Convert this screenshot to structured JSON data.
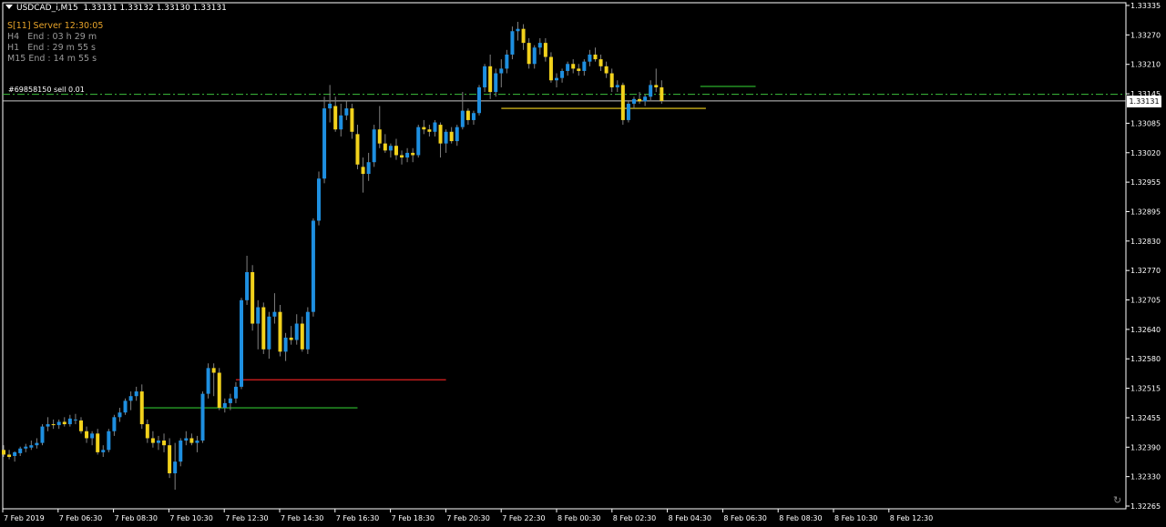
{
  "header": {
    "symbol": "USDCAD_i,M15",
    "quotes": "1.33131 1.33132 1.33130 1.33131"
  },
  "info_panel": {
    "server": "S[11] Server 12:30:05",
    "timeframes": [
      {
        "tf": "H4",
        "text": "End : 03 h 29 m"
      },
      {
        "tf": "H1",
        "text": "End : 29 m 55 s"
      },
      {
        "tf": "M15",
        "text": "End : 14 m 55 s"
      }
    ]
  },
  "trade": {
    "label": "#69858150 sell 0.01",
    "price": 1.33145
  },
  "current_price": "1.33131",
  "colors": {
    "background": "#000000",
    "bull": "#1e8fe0",
    "bear": "#f2d21c",
    "wick": "#808080",
    "axis": "#ffffff",
    "trade_line": "#3cc03c",
    "support": "#2fc22f",
    "resistance": "#e02020",
    "level_yellow": "#f2d21c"
  },
  "chart_data": {
    "type": "candlestick",
    "y_ticks": [
      "1.33335",
      "1.33270",
      "1.33210",
      "1.33145",
      "1.33085",
      "1.33020",
      "1.32955",
      "1.32895",
      "1.32830",
      "1.32770",
      "1.32705",
      "1.32640",
      "1.32580",
      "1.32515",
      "1.32455",
      "1.32390",
      "1.32330",
      "1.32265"
    ],
    "ylim": [
      1.32265,
      1.33335
    ],
    "x_ticks": [
      "7 Feb 2019",
      "7 Feb 06:30",
      "7 Feb 08:30",
      "7 Feb 10:30",
      "7 Feb 12:30",
      "7 Feb 14:30",
      "7 Feb 16:30",
      "7 Feb 18:30",
      "7 Feb 20:30",
      "7 Feb 22:30",
      "8 Feb 00:30",
      "8 Feb 02:30",
      "8 Feb 04:30",
      "8 Feb 06:30",
      "8 Feb 08:30",
      "8 Feb 10:30",
      "8 Feb 12:30"
    ],
    "candles": [
      [
        1.32385,
        1.32395,
        1.3237,
        1.32375
      ],
      [
        1.32375,
        1.32385,
        1.32365,
        1.3237
      ],
      [
        1.32372,
        1.32382,
        1.3236,
        1.3238
      ],
      [
        1.32378,
        1.32392,
        1.32372,
        1.32388
      ],
      [
        1.32388,
        1.32398,
        1.3238,
        1.32392
      ],
      [
        1.3239,
        1.32405,
        1.32385,
        1.32395
      ],
      [
        1.32395,
        1.3241,
        1.32388,
        1.324
      ],
      [
        1.324,
        1.3244,
        1.32395,
        1.32435
      ],
      [
        1.32435,
        1.32455,
        1.32425,
        1.3244
      ],
      [
        1.3244,
        1.3245,
        1.3243,
        1.32438
      ],
      [
        1.32438,
        1.3245,
        1.3243,
        1.32445
      ],
      [
        1.32445,
        1.32455,
        1.32435,
        1.3244
      ],
      [
        1.3244,
        1.3246,
        1.32435,
        1.32452
      ],
      [
        1.3245,
        1.32462,
        1.3244,
        1.3245
      ],
      [
        1.32448,
        1.32455,
        1.3242,
        1.32425
      ],
      [
        1.32425,
        1.32435,
        1.324,
        1.3241
      ],
      [
        1.3241,
        1.32425,
        1.32395,
        1.3242
      ],
      [
        1.3242,
        1.3243,
        1.32375,
        1.3238
      ],
      [
        1.3238,
        1.32395,
        1.3237,
        1.32385
      ],
      [
        1.32385,
        1.3243,
        1.3238,
        1.32425
      ],
      [
        1.32425,
        1.3246,
        1.32415,
        1.32455
      ],
      [
        1.32455,
        1.32475,
        1.32445,
        1.32465
      ],
      [
        1.32465,
        1.32495,
        1.3246,
        1.3249
      ],
      [
        1.3249,
        1.3251,
        1.3247,
        1.325
      ],
      [
        1.325,
        1.3252,
        1.3249,
        1.3251
      ],
      [
        1.3251,
        1.32525,
        1.3243,
        1.3244
      ],
      [
        1.3244,
        1.3245,
        1.324,
        1.3241
      ],
      [
        1.3241,
        1.32425,
        1.3239,
        1.324
      ],
      [
        1.324,
        1.32415,
        1.32385,
        1.32405
      ],
      [
        1.32405,
        1.3242,
        1.3238,
        1.32395
      ],
      [
        1.32395,
        1.3241,
        1.32325,
        1.32335
      ],
      [
        1.32335,
        1.324,
        1.323,
        1.3236
      ],
      [
        1.3236,
        1.3241,
        1.3235,
        1.32405
      ],
      [
        1.32405,
        1.32425,
        1.32395,
        1.3241
      ],
      [
        1.3241,
        1.3242,
        1.32395,
        1.324
      ],
      [
        1.324,
        1.32415,
        1.3238,
        1.32405
      ],
      [
        1.32405,
        1.3251,
        1.324,
        1.32505
      ],
      [
        1.32505,
        1.3257,
        1.32495,
        1.3256
      ],
      [
        1.3256,
        1.3257,
        1.325,
        1.3255
      ],
      [
        1.3255,
        1.3256,
        1.3247,
        1.32475
      ],
      [
        1.32475,
        1.32495,
        1.32465,
        1.32485
      ],
      [
        1.32485,
        1.32505,
        1.3247,
        1.32495
      ],
      [
        1.32495,
        1.3253,
        1.32485,
        1.3252
      ],
      [
        1.3252,
        1.3271,
        1.32515,
        1.32705
      ],
      [
        1.32705,
        1.328,
        1.32695,
        1.32765
      ],
      [
        1.32765,
        1.3278,
        1.3264,
        1.32655
      ],
      [
        1.32655,
        1.32705,
        1.326,
        1.3269
      ],
      [
        1.3269,
        1.327,
        1.3259,
        1.326
      ],
      [
        1.326,
        1.3268,
        1.3258,
        1.3267
      ],
      [
        1.3267,
        1.3272,
        1.32655,
        1.3268
      ],
      [
        1.3268,
        1.32695,
        1.32585,
        1.32595
      ],
      [
        1.32595,
        1.32635,
        1.32575,
        1.32625
      ],
      [
        1.32625,
        1.3265,
        1.3261,
        1.3262
      ],
      [
        1.3262,
        1.32675,
        1.3261,
        1.32655
      ],
      [
        1.32655,
        1.3267,
        1.32595,
        1.326
      ],
      [
        1.326,
        1.3269,
        1.3259,
        1.3268
      ],
      [
        1.3268,
        1.3288,
        1.3267,
        1.32875
      ],
      [
        1.32875,
        1.3298,
        1.32865,
        1.32965
      ],
      [
        1.32965,
        1.3314,
        1.32955,
        1.33115
      ],
      [
        1.33115,
        1.33165,
        1.33085,
        1.33125
      ],
      [
        1.3312,
        1.3314,
        1.33065,
        1.3307
      ],
      [
        1.3307,
        1.33125,
        1.33055,
        1.331
      ],
      [
        1.331,
        1.3313,
        1.3309,
        1.33115
      ],
      [
        1.33115,
        1.33125,
        1.3305,
        1.33065
      ],
      [
        1.3306,
        1.3308,
        1.32985,
        1.32995
      ],
      [
        1.3299,
        1.3301,
        1.32935,
        1.32975
      ],
      [
        1.32975,
        1.3302,
        1.3296,
        1.33
      ],
      [
        1.33,
        1.3308,
        1.3299,
        1.3307
      ],
      [
        1.3307,
        1.3312,
        1.3303,
        1.3304
      ],
      [
        1.3304,
        1.3306,
        1.3302,
        1.33025
      ],
      [
        1.33025,
        1.3304,
        1.3301,
        1.33035
      ],
      [
        1.33035,
        1.3305,
        1.33005,
        1.33015
      ],
      [
        1.33015,
        1.33025,
        1.32995,
        1.3301
      ],
      [
        1.3301,
        1.3303,
        1.33,
        1.3302
      ],
      [
        1.3302,
        1.3303,
        1.33,
        1.33015
      ],
      [
        1.33015,
        1.3308,
        1.3301,
        1.33075
      ],
      [
        1.33075,
        1.3309,
        1.3306,
        1.3307
      ],
      [
        1.3307,
        1.3308,
        1.33055,
        1.33065
      ],
      [
        1.33065,
        1.3309,
        1.33055,
        1.33085
      ],
      [
        1.3308,
        1.33085,
        1.3301,
        1.3304
      ],
      [
        1.3304,
        1.3307,
        1.3302,
        1.33065
      ],
      [
        1.33065,
        1.33075,
        1.3304,
        1.33045
      ],
      [
        1.33045,
        1.3308,
        1.33035,
        1.33075
      ],
      [
        1.33075,
        1.3315,
        1.3307,
        1.3311
      ],
      [
        1.3311,
        1.33115,
        1.3308,
        1.3309
      ],
      [
        1.3309,
        1.3311,
        1.3308,
        1.33105
      ],
      [
        1.33105,
        1.33165,
        1.331,
        1.3316
      ],
      [
        1.3316,
        1.3321,
        1.3315,
        1.33205
      ],
      [
        1.33205,
        1.3323,
        1.33135,
        1.3315
      ],
      [
        1.3315,
        1.332,
        1.3314,
        1.3319
      ],
      [
        1.3319,
        1.3322,
        1.3316,
        1.332
      ],
      [
        1.332,
        1.3324,
        1.3319,
        1.3323
      ],
      [
        1.3323,
        1.3329,
        1.3322,
        1.3328
      ],
      [
        1.3328,
        1.333,
        1.3326,
        1.33285
      ],
      [
        1.33285,
        1.33295,
        1.3324,
        1.33255
      ],
      [
        1.33255,
        1.33265,
        1.332,
        1.3321
      ],
      [
        1.3321,
        1.3325,
        1.332,
        1.33245
      ],
      [
        1.33245,
        1.33265,
        1.3323,
        1.33255
      ],
      [
        1.33255,
        1.33265,
        1.33215,
        1.33225
      ],
      [
        1.33225,
        1.33235,
        1.3317,
        1.33175
      ],
      [
        1.33175,
        1.3319,
        1.3316,
        1.3318
      ],
      [
        1.3318,
        1.332,
        1.3317,
        1.33195
      ],
      [
        1.33195,
        1.33215,
        1.33185,
        1.3321
      ],
      [
        1.3321,
        1.3322,
        1.3319,
        1.332
      ],
      [
        1.332,
        1.3321,
        1.33185,
        1.33195
      ],
      [
        1.33195,
        1.3322,
        1.33185,
        1.33215
      ],
      [
        1.33215,
        1.3324,
        1.33205,
        1.3323
      ],
      [
        1.3323,
        1.33245,
        1.33215,
        1.3322
      ],
      [
        1.3322,
        1.3323,
        1.33195,
        1.33205
      ],
      [
        1.33205,
        1.33215,
        1.3318,
        1.3319
      ],
      [
        1.3319,
        1.332,
        1.3315,
        1.3316
      ],
      [
        1.3316,
        1.33175,
        1.3315,
        1.33165
      ],
      [
        1.33165,
        1.3317,
        1.3308,
        1.3309
      ],
      [
        1.3309,
        1.3313,
        1.33085,
        1.33125
      ],
      [
        1.33125,
        1.3314,
        1.33115,
        1.33135
      ],
      [
        1.33135,
        1.3315,
        1.33125,
        1.3313
      ],
      [
        1.3313,
        1.33145,
        1.3312,
        1.3314
      ],
      [
        1.3314,
        1.33175,
        1.3313,
        1.33165
      ],
      [
        1.33165,
        1.332,
        1.3315,
        1.3316
      ],
      [
        1.3316,
        1.33175,
        1.33125,
        1.33131
      ]
    ],
    "levels": [
      {
        "name": "trade-sell-line",
        "price": 1.33145,
        "style": "dashdot",
        "color": "#3cc03c"
      },
      {
        "name": "current-price-line",
        "price": 1.33131,
        "style": "solid",
        "color": "#c8c8c8"
      }
    ],
    "segments": [
      {
        "name": "support-segment",
        "price": 1.32475,
        "from_bar": 25,
        "to_bar": 64,
        "color": "#2fc22f"
      },
      {
        "name": "resistance-segment",
        "price": 1.32535,
        "from_bar": 42,
        "to_bar": 80,
        "color": "#e02020"
      },
      {
        "name": "yellow-level-segment",
        "price": 1.33115,
        "from_bar": 90,
        "to_bar": 127,
        "color": "#f2d21c"
      },
      {
        "name": "green-box-top",
        "price": 1.33162,
        "from_bar": 126,
        "to_bar": 136,
        "color": "#2fc22f"
      }
    ]
  }
}
